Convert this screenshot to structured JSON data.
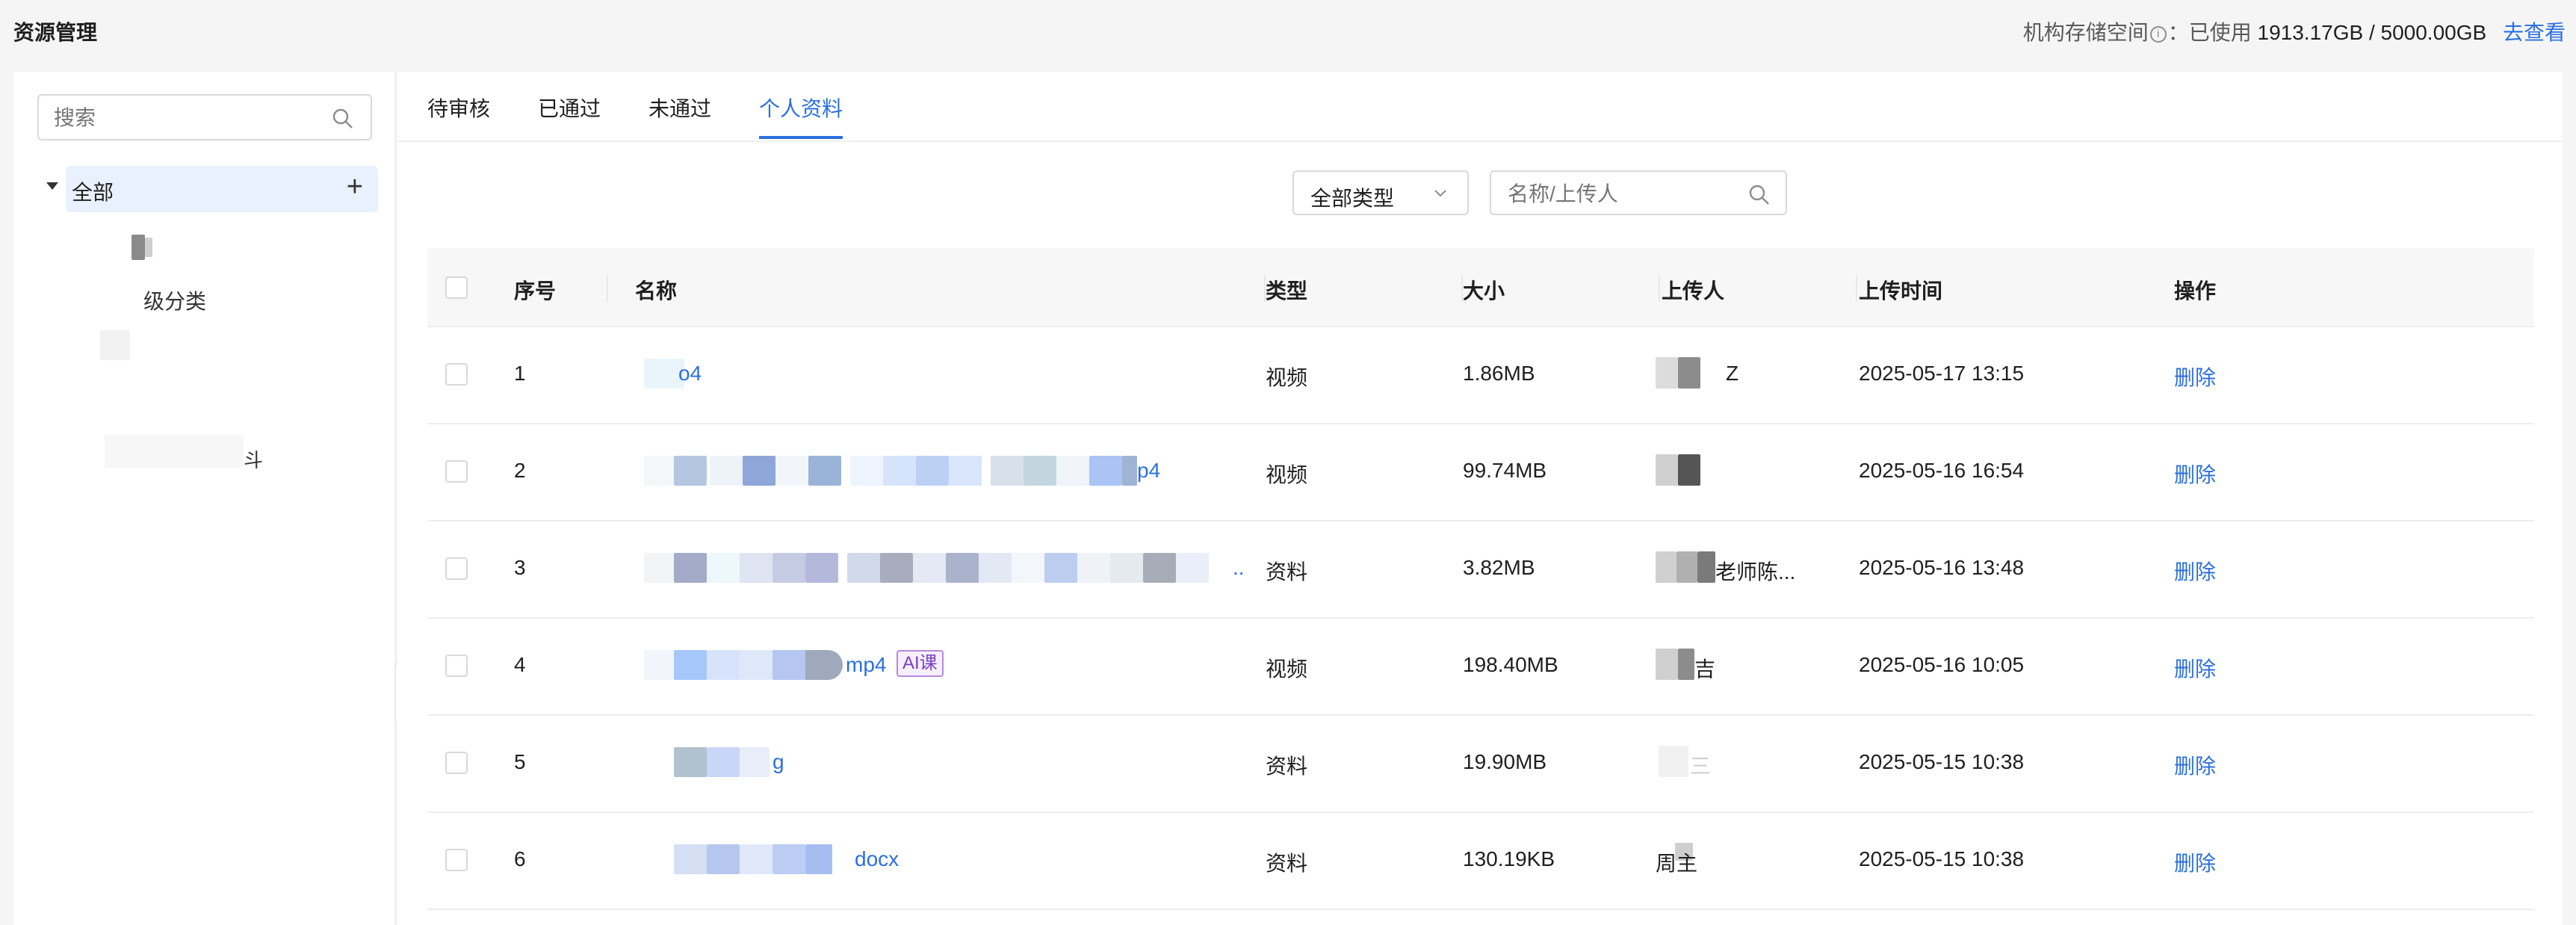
{
  "header": {
    "title": "资源管理",
    "storage_label": "机构存储空间",
    "storage_used_label": "：已使用",
    "storage_value": "1913.17GB / 5000.00GB",
    "storage_link": "去查看"
  },
  "sidebar": {
    "search_placeholder": "搜索",
    "root_label": "全部",
    "child_texts": [
      "级分类",
      "斗"
    ]
  },
  "tabs": [
    {
      "label": "待审核",
      "active": false
    },
    {
      "label": "已通过",
      "active": false
    },
    {
      "label": "未通过",
      "active": false
    },
    {
      "label": "个人资料",
      "active": true
    }
  ],
  "filters": {
    "type_select": "全部类型",
    "search_placeholder": "名称/上传人"
  },
  "table": {
    "columns": [
      "序号",
      "名称",
      "类型",
      "大小",
      "上传人",
      "上传时间",
      "操作"
    ],
    "rows": [
      {
        "index": "1",
        "name_suffix": "o4",
        "type": "视频",
        "size": "1.86MB",
        "uploader_visible": "Z",
        "time": "2025-05-17 13:15",
        "action": "删除"
      },
      {
        "index": "2",
        "name_suffix": "p4",
        "type": "视频",
        "size": "99.74MB",
        "uploader_visible": "",
        "time": "2025-05-16 16:54",
        "action": "删除"
      },
      {
        "index": "3",
        "name_suffix": "..",
        "type": "资料",
        "size": "3.82MB",
        "uploader_visible": "老师陈...",
        "time": "2025-05-16 13:48",
        "action": "删除"
      },
      {
        "index": "4",
        "name_suffix": "mp4",
        "tag": "AI课",
        "type": "视频",
        "size": "198.40MB",
        "uploader_visible": "吉",
        "time": "2025-05-16 10:05",
        "action": "删除"
      },
      {
        "index": "5",
        "name_suffix": "g",
        "type": "资料",
        "size": "19.90MB",
        "uploader_visible": "三",
        "time": "2025-05-15 10:38",
        "action": "删除"
      },
      {
        "index": "6",
        "name_suffix": "docx",
        "type": "资料",
        "size": "130.19KB",
        "uploader_visible": "周主",
        "time": "2025-05-15 10:38",
        "action": "删除"
      }
    ]
  },
  "colors": {
    "accent": "#2b6fe0",
    "tree_selected_bg": "#e8f1fd",
    "table_header_bg": "#f7f7f7",
    "ai_tag": "#7b3fc4"
  },
  "icons": [
    "search-icon",
    "info-icon",
    "caret-down-icon",
    "plus-icon",
    "chevron-down-icon",
    "collapse-left-icon"
  ]
}
